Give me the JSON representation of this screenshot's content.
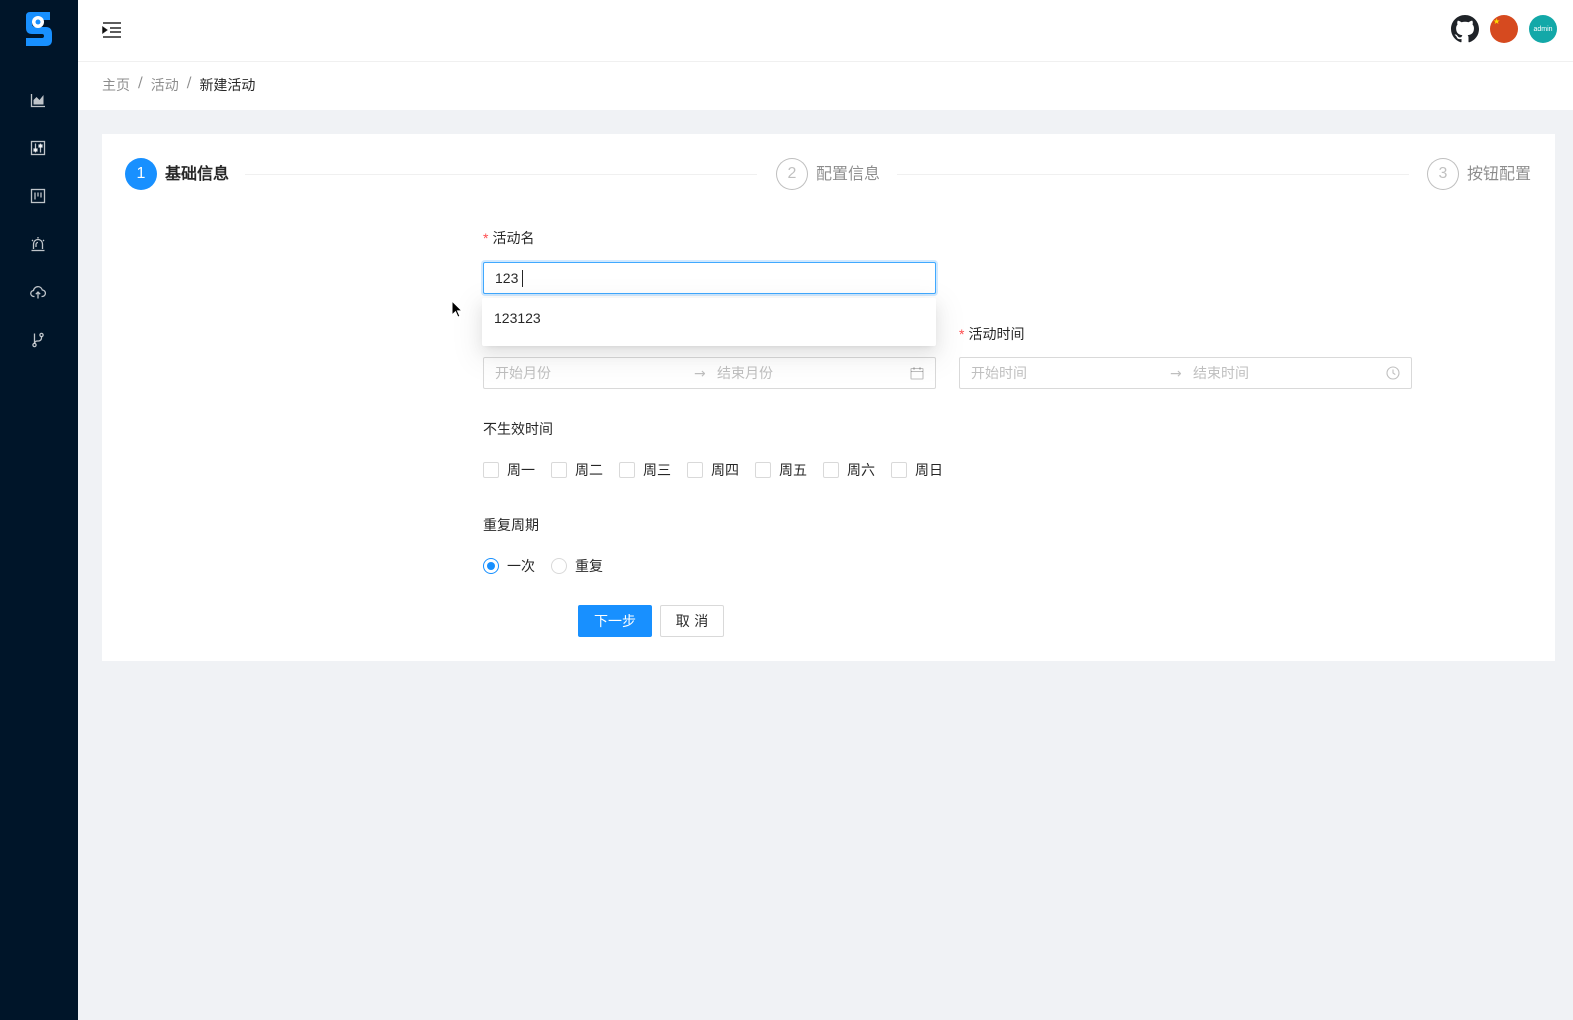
{
  "header": {
    "icons": [
      "menu-fold-icon",
      "github-icon",
      "china-flag-icon",
      "avatar"
    ],
    "avatar_text": "admin"
  },
  "sidebar": {
    "items": [
      "area-chart-icon",
      "control-icon",
      "project-icon",
      "alert-icon",
      "cloud-upload-icon",
      "branches-icon"
    ]
  },
  "breadcrumb": {
    "items": [
      "主页",
      "活动",
      "新建活动"
    ],
    "separator": "/"
  },
  "steps": [
    {
      "number": "1",
      "title": "基础信息",
      "status": "active"
    },
    {
      "number": "2",
      "title": "配置信息",
      "status": "wait"
    },
    {
      "number": "3",
      "title": "按钮配置",
      "status": "wait"
    }
  ],
  "form": {
    "activity_name": {
      "label": "活动名",
      "value": "123",
      "autocomplete": [
        "123123"
      ]
    },
    "month_range": {
      "start_placeholder": "开始月份",
      "end_placeholder": "结束月份",
      "separator": "→"
    },
    "activity_time": {
      "label": "活动时间",
      "start_placeholder": "开始时间",
      "end_placeholder": "结束时间",
      "separator": "→"
    },
    "inactive_time": {
      "label": "不生效时间",
      "options": [
        "周一",
        "周二",
        "周三",
        "周四",
        "周五",
        "周六",
        "周日"
      ]
    },
    "repeat_cycle": {
      "label": "重复周期",
      "options": [
        "一次",
        "重复"
      ],
      "selected": "一次"
    },
    "buttons": {
      "next": "下一步",
      "cancel": "取 消"
    }
  },
  "colors": {
    "primary": "#1890ff",
    "sider_bg": "#001529",
    "required": "#ff4d4f"
  }
}
